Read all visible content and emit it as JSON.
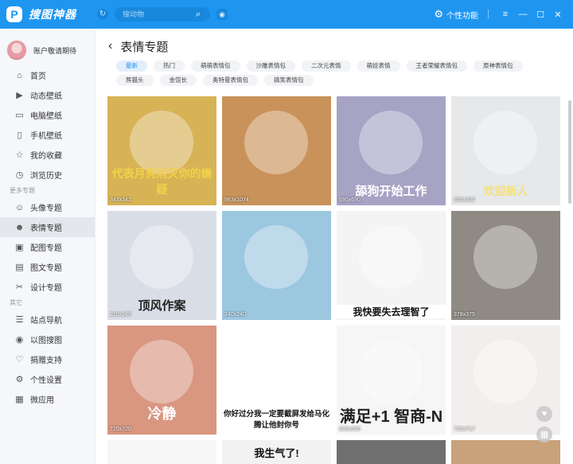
{
  "app": {
    "logo_glyph": "P",
    "name": "搜图神器",
    "search_placeholder": "搜动物",
    "personal_label": "个性功能",
    "accent_color": "#1e96f0"
  },
  "profile": {
    "name": "账户敬请期待"
  },
  "sidebar": {
    "main_items": [
      {
        "label": "首页",
        "icon": "home-icon"
      },
      {
        "label": "动态壁纸",
        "icon": "video-icon"
      },
      {
        "label": "电脑壁纸",
        "icon": "monitor-icon"
      },
      {
        "label": "手机壁纸",
        "icon": "phone-icon"
      },
      {
        "label": "我的收藏",
        "icon": "star-icon"
      },
      {
        "label": "浏览历史",
        "icon": "clock-icon"
      }
    ],
    "section_more": "更多专题",
    "more_items": [
      {
        "label": "头像专题",
        "icon": "avatar-icon"
      },
      {
        "label": "表情专题",
        "icon": "emoji-icon"
      },
      {
        "label": "配图专题",
        "icon": "image-icon"
      },
      {
        "label": "图文专题",
        "icon": "document-icon"
      },
      {
        "label": "设计专题",
        "icon": "design-icon"
      }
    ],
    "section_other": "其它",
    "other_items": [
      {
        "label": "站点导航",
        "icon": "navigation-icon"
      },
      {
        "label": "以图搜图",
        "icon": "camera-icon"
      },
      {
        "label": "捐赠支持",
        "icon": "heart-icon"
      },
      {
        "label": "个性设置",
        "icon": "settings-icon"
      },
      {
        "label": "微应用",
        "icon": "apps-icon"
      }
    ]
  },
  "page": {
    "title": "表情专题",
    "tags": [
      "最新",
      "热门",
      "萌萌表情包",
      "沙雕表情包",
      "二次元表情",
      "萌娃表情",
      "王者荣耀表情包",
      "原神表情包",
      "熊猫头",
      "金馆长",
      "奥特曼表情包",
      "搞笑表情包"
    ],
    "tiles": [
      {
        "res": "343x342",
        "caption": "代表月亮消灭你的嫌疑",
        "bg": "#d8b356"
      },
      {
        "res": "983x1074",
        "caption": "",
        "bg": "#c9925a"
      },
      {
        "res": "690x690",
        "caption": "舔狗开始工作",
        "bg": "#a7a3c5"
      },
      {
        "res": "320x320",
        "caption": "欢迎新人",
        "bg": "#e6e8ea"
      },
      {
        "res": "216x240",
        "caption": "顶风作案",
        "bg": "#d9dde6"
      },
      {
        "res": "240x240",
        "caption": "",
        "bg": "#9bc7e0"
      },
      {
        "res": "",
        "caption": "我快要失去理智了",
        "bg": "#f4f4f4"
      },
      {
        "res": "378x375",
        "caption": "",
        "bg": "#8f8a83"
      },
      {
        "res": "720x720",
        "caption": "冷静",
        "bg": "#d99680"
      },
      {
        "res": "",
        "caption": "你好过分我一定要截屏发给马化腾让他封你号",
        "bg": "#ffffff"
      },
      {
        "res": "630x630",
        "caption": "满足+1 智商-N",
        "bg": "#f6f6f6"
      },
      {
        "res": "720x717",
        "caption": "",
        "bg": "#f3eeee"
      }
    ],
    "partial_caption": "我生气了!"
  }
}
